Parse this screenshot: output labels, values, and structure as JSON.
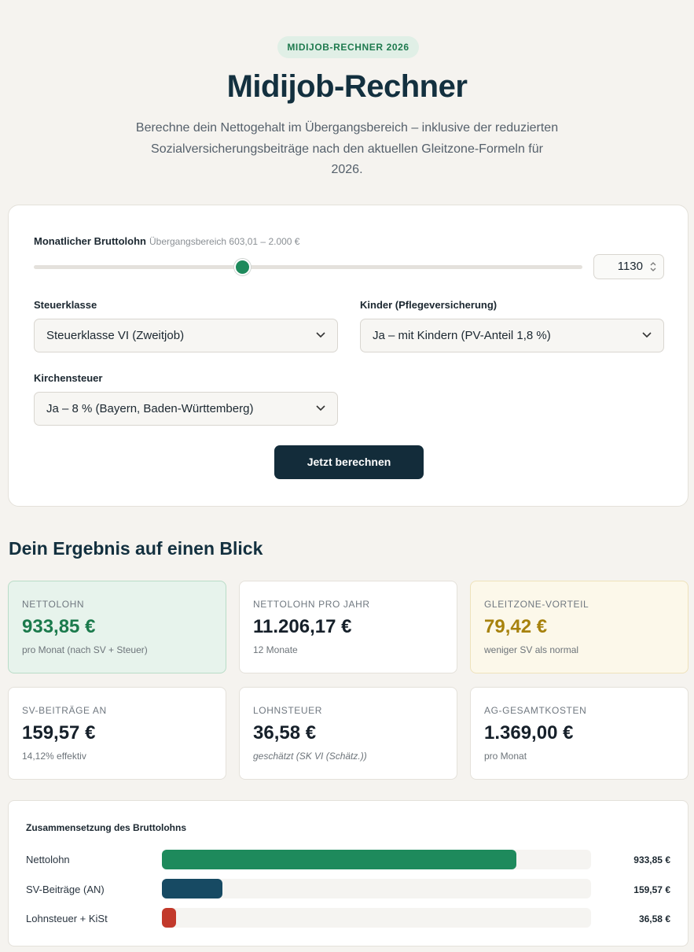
{
  "header": {
    "badge": "MIDIJOB-RECHNER 2026",
    "title": "Midijob-Rechner",
    "lead": "Berechne dein Nettogehalt im Übergangsbereich – inklusive der reduzierten Sozialversicherungsbeiträge nach den aktuellen Gleitzone-Formeln für 2026."
  },
  "form": {
    "gross_label": "Monatlicher Bruttolohn",
    "gross_hint": "Übergangsbereich 603,01 – 2.000 €",
    "gross_value": "1130",
    "slider_fraction": 0.38,
    "tax_class_label": "Steuerklasse",
    "tax_class_value": "Steuerklasse VI (Zweitjob)",
    "children_label": "Kinder (Pflegeversicherung)",
    "children_value": "Ja – mit Kindern (PV-Anteil 1,8 %)",
    "church_label": "Kirchensteuer",
    "church_value": "Ja – 8 % (Bayern, Baden-Württemberg)",
    "submit_label": "Jetzt berechnen"
  },
  "results": {
    "heading": "Dein Ergebnis auf einen Blick",
    "cards": [
      {
        "key": "NETTOLOHN",
        "value": "933,85 €",
        "sub": "pro Monat (nach SV + Steuer)"
      },
      {
        "key": "NETTOLOHN PRO JAHR",
        "value": "11.206,17 €",
        "sub": "12 Monate"
      },
      {
        "key": "GLEITZONE-VORTEIL",
        "value": "79,42 €",
        "sub": "weniger SV als normal"
      },
      {
        "key": "SV-BEITRÄGE AN",
        "value": "159,57 €",
        "sub": "14,12% effektiv"
      },
      {
        "key": "LOHNSTEUER",
        "value": "36,58 €",
        "sub": "geschätzt (SK VI (Schätz.))"
      },
      {
        "key": "AG-GESAMTKOSTEN",
        "value": "1.369,00 €",
        "sub": "pro Monat"
      }
    ]
  },
  "breakdown": {
    "title": "Zusammensetzung des Bruttolohns",
    "rows": [
      {
        "label": "Nettolohn",
        "value_text": "933,85 €",
        "value": 933.85,
        "color": "#1e8a5c"
      },
      {
        "label": "SV-Beiträge (AN)",
        "value_text": "159,57 €",
        "value": 159.57,
        "color": "#174a63"
      },
      {
        "label": "Lohnsteuer + KiSt",
        "value_text": "36,58 €",
        "value": 36.58,
        "color": "#c2392b"
      }
    ],
    "total": 1130
  }
}
